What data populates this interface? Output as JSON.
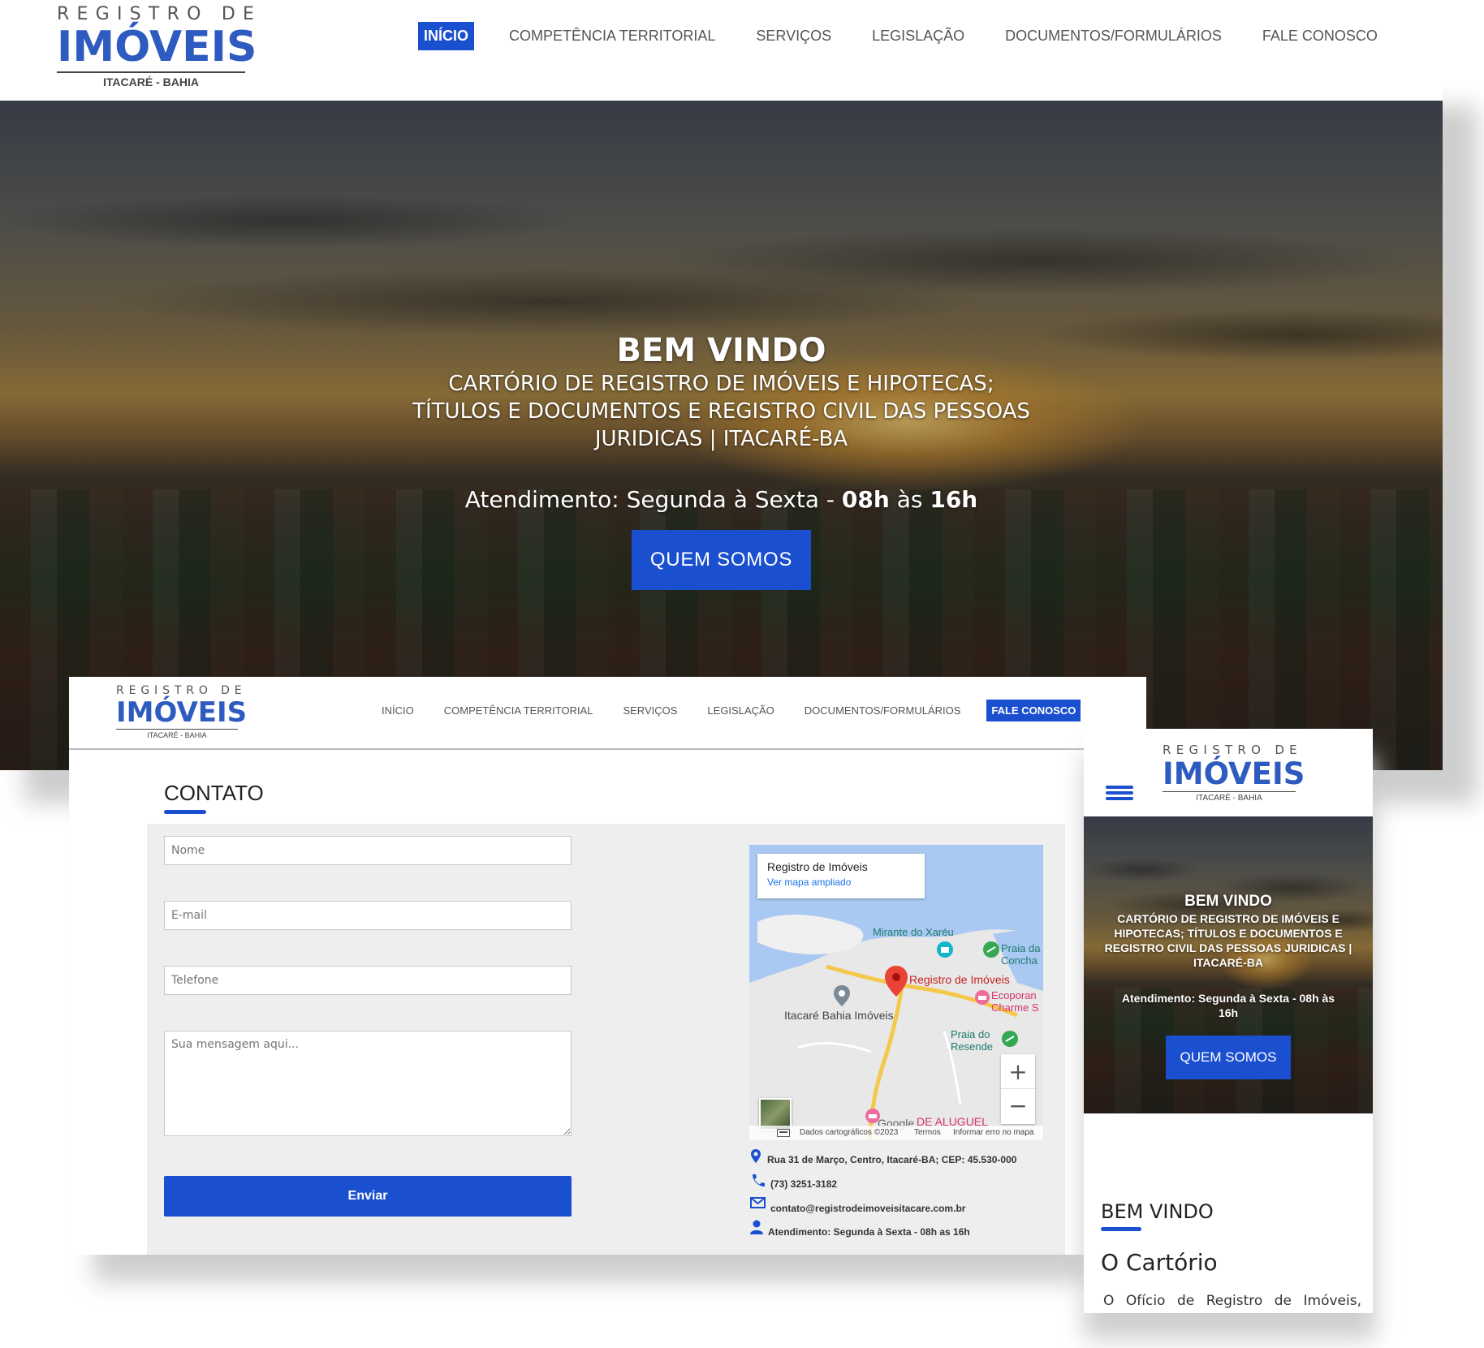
{
  "logo": {
    "line1": "REGISTRO DE",
    "line2": "IMÓVEIS",
    "line3": "ITACARÉ - BAHIA"
  },
  "nav": {
    "items": [
      "INÍCIO",
      "COMPETÊNCIA TERRITORIAL",
      "SERVIÇOS",
      "LEGISLAÇÃO",
      "DOCUMENTOS/FORMULÁRIOS",
      "FALE CONOSCO"
    ]
  },
  "hero": {
    "title": "BEM VINDO",
    "subtitle_line1": "CARTÓRIO DE REGISTRO DE IMÓVEIS E HIPOTECAS;",
    "subtitle_line2": "TÍTULOS E DOCUMENTOS E REGISTRO CIVIL DAS PESSOAS",
    "subtitle_line3": "JURIDICAS | ITACARÉ-BA",
    "hours_prefix": "Atendimento: Segunda à Sexta - ",
    "hours_start": "08h",
    "hours_mid": " às ",
    "hours_end": "16h",
    "button": "QUEM SOMOS"
  },
  "mobile_hero": {
    "subtitle_line1": "CARTÓRIO DE REGISTRO DE IMÓVEIS E",
    "subtitle_line2": "HIPOTECAS; TÍTULOS E DOCUMENTOS E",
    "subtitle_line3": "REGISTRO CIVIL DAS PESSOAS JURIDICAS |",
    "subtitle_line4": "ITACARÉ-BA",
    "hours_line1_prefix": "Atendimento: Segunda à Sexta - ",
    "hours_line1_bold": "08h",
    "hours_line1_suffix": " às",
    "hours_line2": "16h"
  },
  "contact": {
    "title": "CONTATO",
    "name_placeholder": "Nome",
    "email_placeholder": "E-mail",
    "phone_placeholder": "Telefone",
    "message_placeholder": "Sua mensagem aqui...",
    "submit": "Enviar"
  },
  "map": {
    "place_name": "Registro de Imóveis",
    "larger_map_link": "Ver mapa ampliado",
    "labels": {
      "mirante": "Mirante do Xaréu",
      "praia_concha_1": "Praia da",
      "praia_concha_2": "Concha",
      "registro": "Registro de Imóveis",
      "ecoporan_1": "Ecoporan",
      "ecoporan_2": "Charme S",
      "itacare_bahia": "Itacaré Bahia Imóveis",
      "praia_resende_1": "Praia do",
      "praia_resende_2": "Resende",
      "aluguel": "DE ALUGUEL",
      "google": "Google"
    },
    "zoom_in": "+",
    "zoom_out": "−",
    "footer": {
      "data": "Dados cartográficos ©2023",
      "terms": "Termos",
      "report": "Informar erro no mapa"
    }
  },
  "contact_info": {
    "address": "Rua 31 de Março, Centro, Itacaré-BA; CEP: 45.530-000",
    "phone": "(73) 3251-3182",
    "email": "contato@registrodeimoveisitacare.com.br",
    "hours": "Atendimento: Segunda à Sexta - 08h as 16h"
  },
  "about": {
    "heading": "BEM VINDO",
    "title": "O Cartório",
    "text": "O Ofício de Registro de Imóveis,"
  },
  "colors": {
    "brand_blue": "#1a4fd0",
    "logo_blue": "#2d5bc0"
  }
}
